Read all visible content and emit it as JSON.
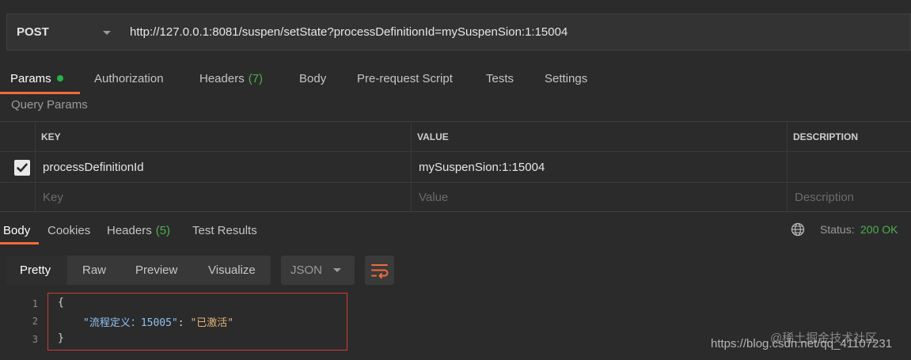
{
  "request": {
    "method": "POST",
    "url": "http://127.0.0.1:8081/suspen/setState?processDefinitionId=mySuspenSion:1:15004"
  },
  "request_tabs": [
    {
      "label": "Params",
      "count": "",
      "dot": true
    },
    {
      "label": "Authorization",
      "count": ""
    },
    {
      "label": "Headers",
      "count": "(7)"
    },
    {
      "label": "Body",
      "count": ""
    },
    {
      "label": "Pre-request Script",
      "count": ""
    },
    {
      "label": "Tests",
      "count": ""
    },
    {
      "label": "Settings",
      "count": ""
    }
  ],
  "query_params": {
    "title": "Query Params",
    "columns": [
      "KEY",
      "VALUE",
      "DESCRIPTION"
    ],
    "rows": [
      {
        "checked": true,
        "key": "processDefinitionId",
        "value": "mySuspenSion:1:15004",
        "description": ""
      }
    ],
    "placeholders": {
      "key": "Key",
      "value": "Value",
      "description": "Description"
    }
  },
  "response_tabs": [
    {
      "label": "Body",
      "count": ""
    },
    {
      "label": "Cookies",
      "count": ""
    },
    {
      "label": "Headers",
      "count": "(5)"
    },
    {
      "label": "Test Results",
      "count": ""
    }
  ],
  "status": {
    "label": "Status:",
    "value": "200 OK",
    "color": "#4caf50"
  },
  "view_modes": [
    "Pretty",
    "Raw",
    "Preview",
    "Visualize"
  ],
  "format": "JSON",
  "code": {
    "line_numbers": [
      "1",
      "2",
      "3"
    ],
    "open_brace": "{",
    "key": "\"流程定义：15005\"",
    "colon": ": ",
    "value": "\"已激活\"",
    "close_brace": "}"
  },
  "watermark": {
    "line1": "@稀土掘金技术社区",
    "line2": "https://blog.csdn.net/qq_41107231"
  },
  "colors": {
    "accent": "#f26b3a",
    "success": "#4caf50",
    "highlight_box": "#d23a3a"
  }
}
